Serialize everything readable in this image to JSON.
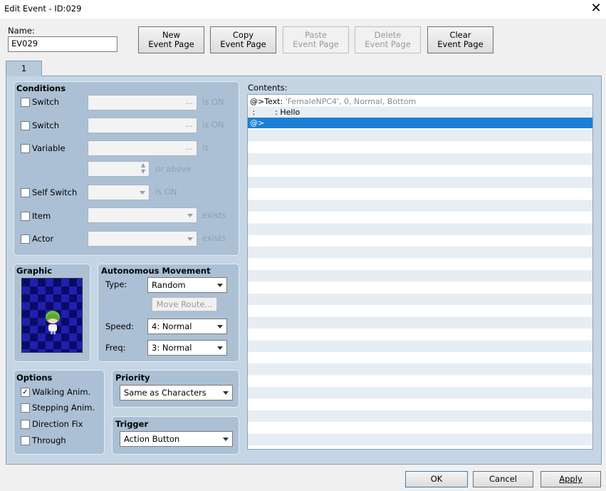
{
  "window": {
    "title": "Edit Event - ID:029"
  },
  "name": {
    "label": "Name:",
    "value": "EV029"
  },
  "toolbar": {
    "new_page": [
      "New",
      "Event Page"
    ],
    "copy_page": [
      "Copy",
      "Event Page"
    ],
    "paste_page": [
      "Paste",
      "Event Page"
    ],
    "delete_page": [
      "Delete",
      "Event Page"
    ],
    "clear_page": [
      "Clear",
      "Event Page"
    ]
  },
  "tabs": [
    {
      "label": "1"
    }
  ],
  "conditions": {
    "title": "Conditions",
    "switch1": {
      "label": "Switch",
      "suffix": "is ON"
    },
    "switch2": {
      "label": "Switch",
      "suffix": "is ON"
    },
    "variable": {
      "label": "Variable",
      "suffix": "is",
      "suffix2": "or above"
    },
    "self_switch": {
      "label": "Self Switch",
      "suffix": "is ON"
    },
    "item": {
      "label": "Item",
      "suffix": "exists"
    },
    "actor": {
      "label": "Actor",
      "suffix": "exists"
    },
    "ellipsis": "..."
  },
  "graphic": {
    "title": "Graphic"
  },
  "movement": {
    "title": "Autonomous Movement",
    "type_label": "Type:",
    "type_value": "Random",
    "move_route": "Move Route...",
    "speed_label": "Speed:",
    "speed_value": "4: Normal",
    "freq_label": "Freq:",
    "freq_value": "3: Normal"
  },
  "options": {
    "title": "Options",
    "walking": {
      "label": "Walking Anim.",
      "checked": true
    },
    "stepping": {
      "label": "Stepping Anim.",
      "checked": false
    },
    "direction_fix": {
      "label": "Direction Fix",
      "checked": false
    },
    "through": {
      "label": "Through",
      "checked": false
    },
    "check_mark": "✓"
  },
  "priority": {
    "title": "Priority",
    "value": "Same as Characters"
  },
  "trigger": {
    "title": "Trigger",
    "value": "Action Button"
  },
  "contents": {
    "label": "Contents:",
    "line1_prefix": "@>Text:",
    "line1_rest": "'FemaleNPC4', 0, Normal, Bottom",
    "line2_prefix": " :        : ",
    "line2_text": "Hello",
    "line3": "@>"
  },
  "footer": {
    "ok": "OK",
    "cancel": "Cancel",
    "apply": "Apply"
  },
  "colors": {
    "selection": "#1a7fd6",
    "panel": "#c5d5e4",
    "group": "#abc0d4"
  }
}
